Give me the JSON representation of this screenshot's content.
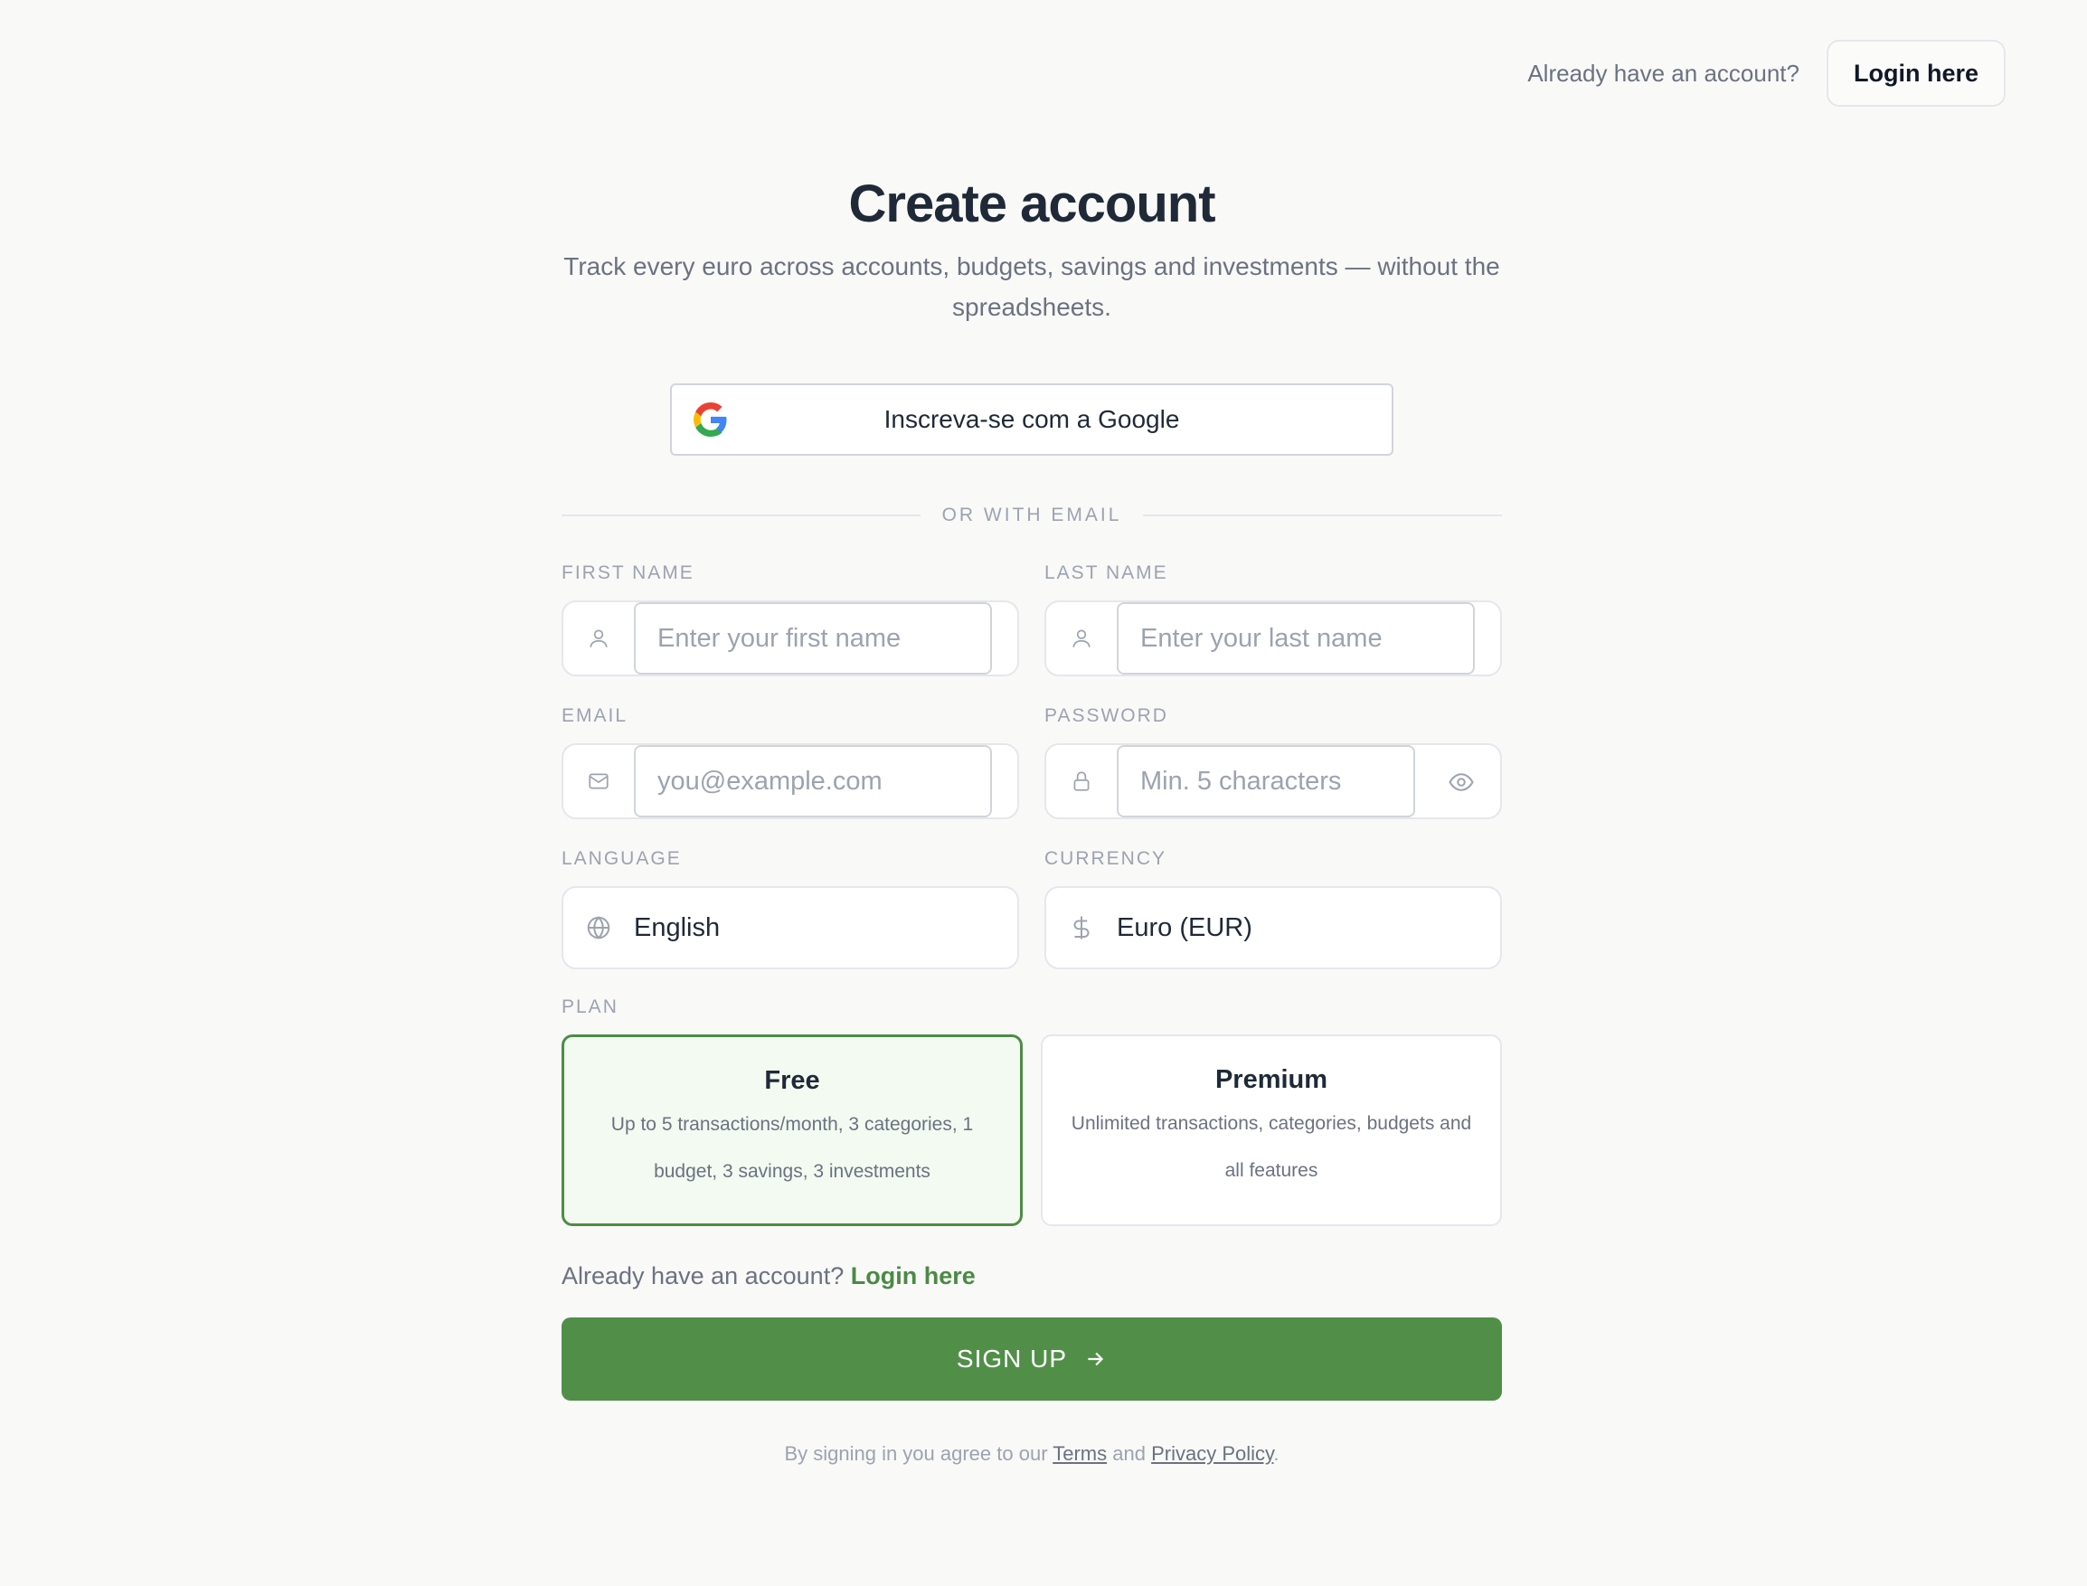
{
  "header": {
    "question": "Already have an account?",
    "login_button": "Login here"
  },
  "hero": {
    "title": "Create account",
    "subtitle": "Track every euro across accounts, budgets, savings and investments — without the spreadsheets."
  },
  "google": {
    "label": "Inscreva-se com a Google",
    "icon": "google-g-logo"
  },
  "divider_label": "OR WITH EMAIL",
  "form": {
    "first_name": {
      "label": "FIRST NAME",
      "placeholder": "Enter your first name",
      "icon": "user-icon"
    },
    "last_name": {
      "label": "LAST NAME",
      "placeholder": "Enter your last name",
      "icon": "user-icon"
    },
    "email": {
      "label": "EMAIL",
      "placeholder": "you@example.com",
      "icon": "mail-icon"
    },
    "password": {
      "label": "PASSWORD",
      "placeholder": "Min. 5 characters",
      "icon": "lock-icon"
    },
    "language": {
      "label": "LANGUAGE",
      "value": "English",
      "icon": "globe-icon"
    },
    "currency": {
      "label": "CURRENCY",
      "value": "Euro (EUR)",
      "icon": "dollar-icon"
    }
  },
  "plan": {
    "label": "PLAN",
    "options": [
      {
        "name": "Free",
        "desc": "Up to 5 transactions/month, 3 categories, 1 budget, 3 savings, 3 investments",
        "selected": true
      },
      {
        "name": "Premium",
        "desc": "Unlimited transactions, categories, budgets and all features",
        "selected": false
      }
    ]
  },
  "login_line": {
    "text": "Already have an account?",
    "link": "Login here"
  },
  "signup_button": "SIGN UP",
  "terms": {
    "prefix": "By signing in you agree to our",
    "terms": "Terms",
    "and": "and",
    "privacy": "Privacy Policy",
    "suffix": "."
  },
  "colors": {
    "accent": "#518f48",
    "link": "#4a8a43",
    "selected_bg": "#f2faf1"
  }
}
